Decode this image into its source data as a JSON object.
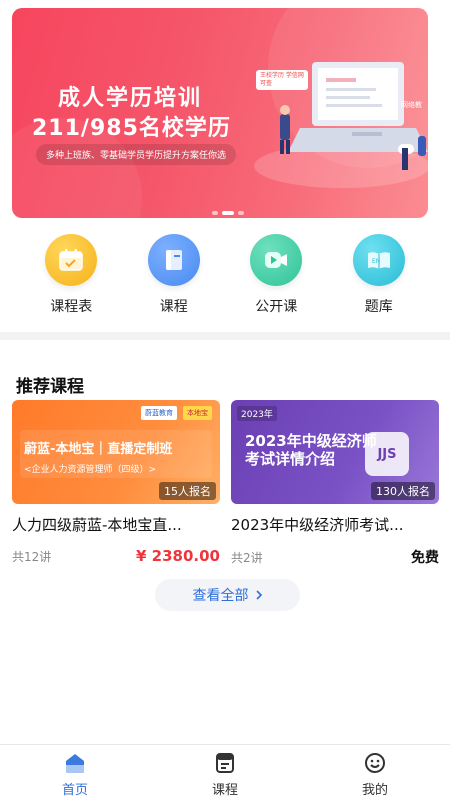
{
  "banner": {
    "title_line1": "成人学历培训",
    "title_line2": "211/985名校学历",
    "subtitle": "多种上班族、零基础学员学历提升方案任你选",
    "tag_text": "王校学历 学信网可查",
    "corner_text": "网络教",
    "dots_count": 3,
    "active_dot": 2
  },
  "quick_nav": [
    {
      "label": "课程表",
      "icon": "calendar-icon",
      "color": "#f6b21a"
    },
    {
      "label": "课程",
      "icon": "book-icon",
      "color": "#4a8af0"
    },
    {
      "label": "公开课",
      "icon": "play-video-icon",
      "color": "#2fc49a"
    },
    {
      "label": "题库",
      "icon": "question-bank-icon",
      "color": "#29bcd6"
    }
  ],
  "section": {
    "title": "推荐课程",
    "view_all": "查看全部"
  },
  "courses": [
    {
      "cover_title": "蔚蓝-本地宝｜直播定制班",
      "cover_sub": "<企业人力资源管理师（四级）>",
      "logo1": "蔚蓝教育",
      "logo2": "本地宝",
      "enroll": "15人报名",
      "title": "人力四级蔚蓝-本地宝直...",
      "lessons": "共12讲",
      "price": "¥ 2380.00"
    },
    {
      "year": "2023年",
      "cover_title1": "2023年中级经济师",
      "cover_title2": "考试详情介绍",
      "badge": "JJS",
      "enroll": "130人报名",
      "title": "2023年中级经济师考试...",
      "lessons": "共2讲",
      "price": "免费"
    }
  ],
  "tabbar": [
    {
      "label": "首页",
      "icon": "home-icon",
      "active": true
    },
    {
      "label": "课程",
      "icon": "course-list-icon",
      "active": false
    },
    {
      "label": "我的",
      "icon": "smiley-profile-icon",
      "active": false
    }
  ],
  "colors": {
    "accent": "#2f6fd8",
    "price": "#f0343c",
    "banner": "#f6465e"
  }
}
